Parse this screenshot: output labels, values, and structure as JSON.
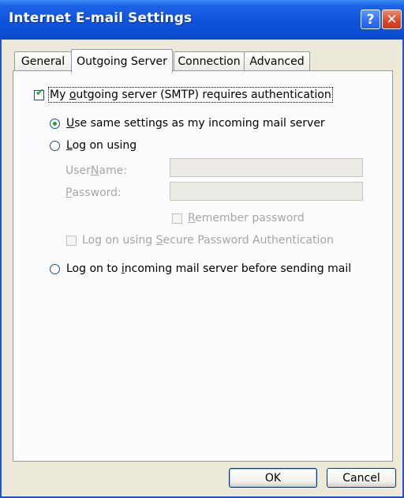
{
  "window": {
    "title": "Internet E-mail Settings",
    "help_icon": "help-icon",
    "help_glyph": "?",
    "close_icon": "close-icon",
    "close_glyph": "✕"
  },
  "tabs": [
    {
      "label": "General",
      "active": false
    },
    {
      "label": "Outgoing Server",
      "active": true
    },
    {
      "label": "Connection",
      "active": false
    },
    {
      "label": "Advanced",
      "active": false
    }
  ],
  "outgoing": {
    "smtp_auth": {
      "pre": "My ",
      "u": "o",
      "post": "utgoing server (SMTP) requires authentication",
      "checked": true
    },
    "same_settings": {
      "u": "U",
      "post": "se same settings as my incoming mail server",
      "selected": true
    },
    "log_on_using": {
      "u": "L",
      "post": "og on using",
      "selected": false
    },
    "username_label": {
      "pre": "User ",
      "u": "N",
      "post": "ame:"
    },
    "password_label": {
      "u": "P",
      "post": "assword:"
    },
    "username_value": "",
    "password_value": "",
    "remember_password": {
      "u": "R",
      "post": "emember password",
      "checked": false
    },
    "spa": {
      "pre": "Log on using ",
      "u": "S",
      "post": "ecure Password Authentication",
      "checked": false
    },
    "log_on_incoming": {
      "pre": "Log on to ",
      "u": "i",
      "post": "ncoming mail server before sending mail",
      "selected": false
    }
  },
  "buttons": {
    "ok": "OK",
    "cancel": "Cancel"
  },
  "colors": {
    "titlebar": "#0b4ed3",
    "check_mark": "#21a121",
    "disabled_text": "#a6a6a6",
    "dialog_bg": "#ece9d8"
  }
}
